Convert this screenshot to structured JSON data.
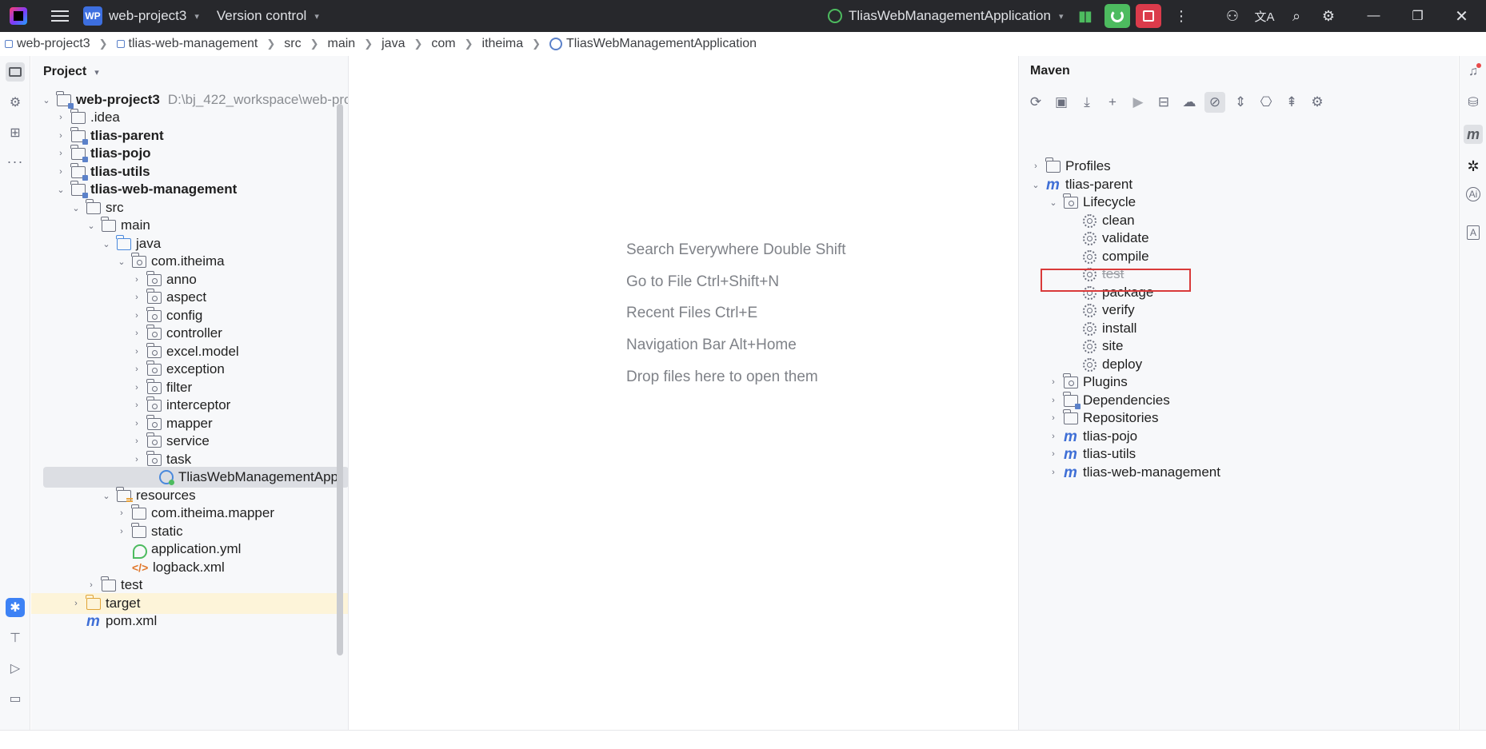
{
  "titlebar": {
    "project_badge": "WP",
    "project_name": "web-project3",
    "version_control": "Version control",
    "run_config": "TliasWebManagementApplication"
  },
  "breadcrumb": [
    "web-project3",
    "tlias-web-management",
    "src",
    "main",
    "java",
    "com",
    "itheima",
    "TliasWebManagementApplication"
  ],
  "project_panel": {
    "title": "Project",
    "root_name": "web-project3",
    "root_path": "D:\\bj_422_workspace\\web-pro",
    "items": [
      {
        "label": ".idea"
      },
      {
        "label": "tlias-parent"
      },
      {
        "label": "tlias-pojo"
      },
      {
        "label": "tlias-utils"
      },
      {
        "label": "tlias-web-management"
      },
      {
        "label": "src"
      },
      {
        "label": "main"
      },
      {
        "label": "java"
      },
      {
        "label": "com.itheima"
      },
      {
        "label": "anno"
      },
      {
        "label": "aspect"
      },
      {
        "label": "config"
      },
      {
        "label": "controller"
      },
      {
        "label": "excel.model"
      },
      {
        "label": "exception"
      },
      {
        "label": "filter"
      },
      {
        "label": "interceptor"
      },
      {
        "label": "mapper"
      },
      {
        "label": "service"
      },
      {
        "label": "task"
      },
      {
        "label": "TliasWebManagementApp"
      },
      {
        "label": "resources"
      },
      {
        "label": "com.itheima.mapper"
      },
      {
        "label": "static"
      },
      {
        "label": "application.yml"
      },
      {
        "label": "logback.xml"
      },
      {
        "label": "test"
      },
      {
        "label": "target"
      },
      {
        "label": "pom.xml"
      }
    ]
  },
  "editor": {
    "hints": [
      "Search Everywhere Double Shift",
      "Go to File Ctrl+Shift+N",
      "Recent Files Ctrl+E",
      "Navigation Bar Alt+Home",
      "Drop files here to open them"
    ]
  },
  "maven": {
    "title": "Maven",
    "items": [
      {
        "label": "Profiles"
      },
      {
        "label": "tlias-parent"
      },
      {
        "label": "Lifecycle"
      },
      {
        "label": "clean"
      },
      {
        "label": "validate"
      },
      {
        "label": "compile"
      },
      {
        "label": "test"
      },
      {
        "label": "package"
      },
      {
        "label": "verify"
      },
      {
        "label": "install"
      },
      {
        "label": "site"
      },
      {
        "label": "deploy"
      },
      {
        "label": "Plugins"
      },
      {
        "label": "Dependencies"
      },
      {
        "label": "Repositories"
      },
      {
        "label": "tlias-pojo"
      },
      {
        "label": "tlias-utils"
      },
      {
        "label": "tlias-web-management"
      }
    ]
  },
  "colors": {
    "titlebar_bg": "#27282c",
    "run_green": "#4dbb5f",
    "stop_red": "#db3b4b",
    "highlight_border": "#d93a3a",
    "selection_bg": "#dcdee3",
    "target_bg": "#fdf4d9"
  }
}
